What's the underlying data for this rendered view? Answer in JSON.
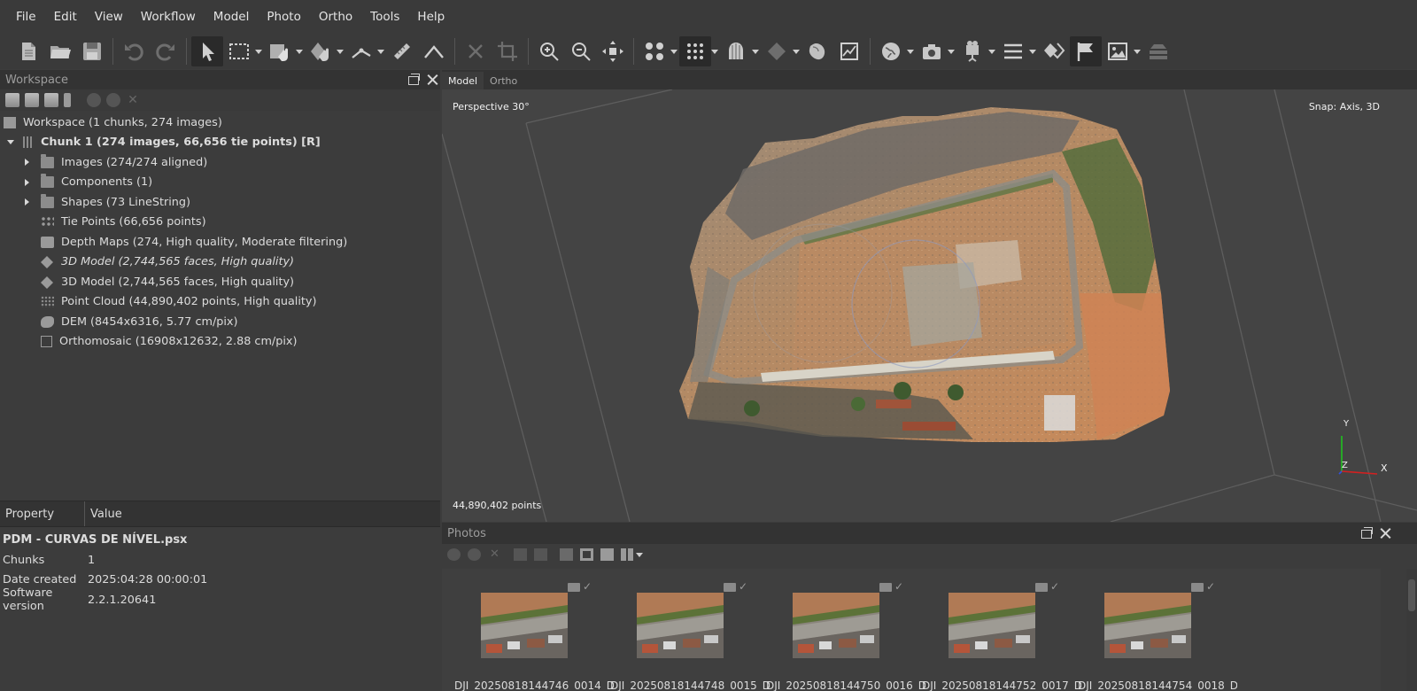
{
  "menu": [
    "File",
    "Edit",
    "View",
    "Workflow",
    "Model",
    "Photo",
    "Ortho",
    "Tools",
    "Help"
  ],
  "toolbar": {
    "icons": [
      "new-document-icon",
      "open-folder-icon",
      "save-icon",
      "undo-icon",
      "redo-icon",
      "navigation-arrow-icon",
      "rectangle-selection-icon",
      "shape-draw-icon",
      "model-rotate-icon",
      "ruler-polyline-icon",
      "ruler-icon",
      "angle-icon",
      "delete-selection-icon",
      "crop-selection-icon",
      "zoom-in-icon",
      "zoom-out-icon",
      "reset-view-icon",
      "show-cameras-icon",
      "show-points-icon",
      "show-model-icon",
      "show-mesh-icon",
      "show-tiled-model-icon",
      "show-dem-icon",
      "show-globe-icon",
      "capture-view-icon",
      "camera-icon",
      "show-shapes-icon",
      "show-layers-icon",
      "show-markers-icon",
      "show-orthomosaic-icon",
      "show-regions-icon"
    ]
  },
  "workspace": {
    "title": "Workspace",
    "items": [
      {
        "label": "Workspace (1 chunks, 274 images)",
        "icon": "workspace-icon"
      },
      {
        "label": "Chunk 1 (274 images, 66,656 tie points) [R]",
        "icon": "chunk-icon"
      },
      {
        "label": "Images (274/274 aligned)",
        "icon": "folder-icon"
      },
      {
        "label": "Components (1)",
        "icon": "folder-icon"
      },
      {
        "label": "Shapes (73 LineString)",
        "icon": "folder-icon"
      },
      {
        "label": "Tie Points (66,656 points)",
        "icon": "tie-points-icon"
      },
      {
        "label": "Depth Maps (274, High quality, Moderate filtering)",
        "icon": "depth-maps-icon"
      },
      {
        "label": "3D Model (2,744,565 faces, High quality)",
        "icon": "model-icon"
      },
      {
        "label": "3D Model (2,744,565 faces, High quality)",
        "icon": "model-icon"
      },
      {
        "label": "Point Cloud (44,890,402 points, High quality)",
        "icon": "point-cloud-icon"
      },
      {
        "label": "DEM (8454x6316, 5.77 cm/pix)",
        "icon": "dem-icon"
      },
      {
        "label": "Orthomosaic (16908x12632, 2.88 cm/pix)",
        "icon": "orthomosaic-icon"
      }
    ]
  },
  "properties": {
    "headers": {
      "property": "Property",
      "value": "Value"
    },
    "title": "PDM - CURVAS DE NÍVEL.psx",
    "rows": [
      {
        "key": "Chunks",
        "value": "1"
      },
      {
        "key": "Date created",
        "value": "2025:04:28 00:00:01"
      },
      {
        "key": "Software version",
        "value": "2.2.1.20641"
      }
    ]
  },
  "viewport": {
    "tabs": [
      "Model",
      "Ortho"
    ],
    "projection": "Perspective 30°",
    "snap": "Snap: Axis, 3D",
    "points_count": "44,890,402 points",
    "axes": {
      "x": "X",
      "y": "Y",
      "z": "Z"
    }
  },
  "photos": {
    "title": "Photos",
    "items": [
      "DJI_20250818144746_0014_D",
      "DJI_20250818144748_0015_D",
      "DJI_20250818144750_0016_D",
      "DJI_20250818144752_0017_D",
      "DJI_20250818144754_0018_D"
    ]
  },
  "colors": {
    "background": "#3c3c3c",
    "menubar": "#3a3a3a",
    "viewport": "#444444",
    "terrain": "#b87d55",
    "axis_x": "#d42020",
    "axis_y": "#20c020"
  }
}
